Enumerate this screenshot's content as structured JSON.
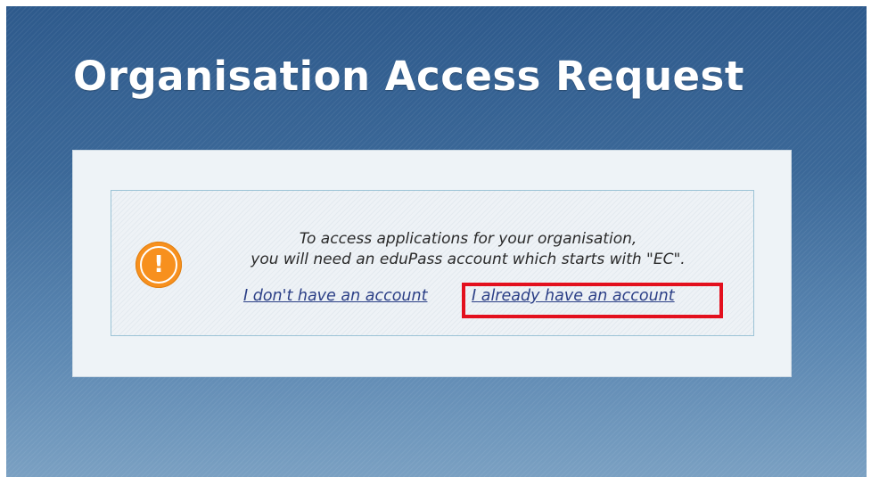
{
  "page": {
    "title": "Organisation Access Request"
  },
  "notice": {
    "icon": "warning-icon",
    "line1": "To access applications for your organisation,",
    "line2": "you will need an eduPass account which starts with \"EC\".",
    "links": {
      "no_account": "I don't have an account",
      "has_account": "I already have an account"
    }
  },
  "colors": {
    "background_top": "#2e5a8c",
    "background_bottom": "#7aa0c2",
    "panel": "#eef3f7",
    "warning": "#f7901e",
    "link": "#2b3f86",
    "highlight": "#e3101e"
  }
}
